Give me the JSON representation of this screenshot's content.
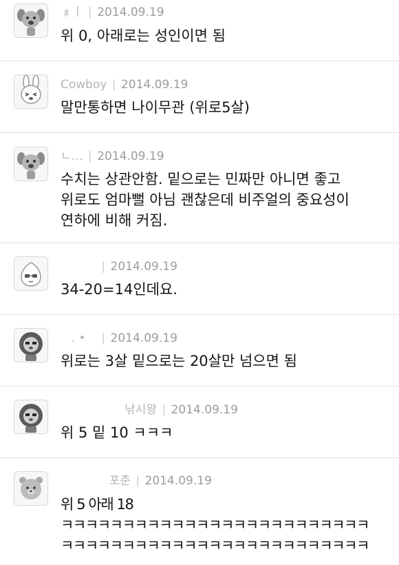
{
  "comments": [
    {
      "author": "﹟ㅣ",
      "date": "2014.09.19",
      "text": "위 0, 아래로는 성인이면 됨",
      "avatar_icon": "dog-icon"
    },
    {
      "author": "Cowboy",
      "date": "2014.09.19",
      "text": "말만통하면 나이무관 (위로5살)",
      "avatar_icon": "rabbit-icon"
    },
    {
      "author": "ㄴ…",
      "date": "2014.09.19",
      "text": "수치는 상관안함. 밑으로는 민짜만 아니면 좋고\n위로도 엄마뻘 아님 괜찮은데 비주얼의 중요성이\n연하에 비해 커짐.",
      "avatar_icon": "dog-icon"
    },
    {
      "author": "",
      "date": "2014.09.19",
      "text": "34-20=14인데요.",
      "avatar_icon": "peach-icon"
    },
    {
      "author": ". •",
      "date": "2014.09.19",
      "text": "위로는 3살 밑으로는 20살만 넘으면 됨",
      "avatar_icon": "lion-icon"
    },
    {
      "author": "낚시왕",
      "date": "2014.09.19",
      "text": "위 5 밑 10 ㅋㅋㅋ",
      "avatar_icon": "lion-icon"
    },
    {
      "author": "포춘",
      "date": "2014.09.19",
      "text": "위 5 아래 18\nㅋㅋㅋㅋㅋㅋㅋㅋㅋㅋㅋㅋㅋㅋㅋㅋㅋㅋㅋㅋㅋㅋㅋㅋㅋ\nㅋㅋㅋㅋㅋㅋㅋㅋㅋㅋㅋㅋㅋㅋㅋㅋㅋㅋㅋㅋㅋㅋㅋㅋㅋ",
      "avatar_icon": "bear-icon"
    }
  ],
  "separator": "|"
}
